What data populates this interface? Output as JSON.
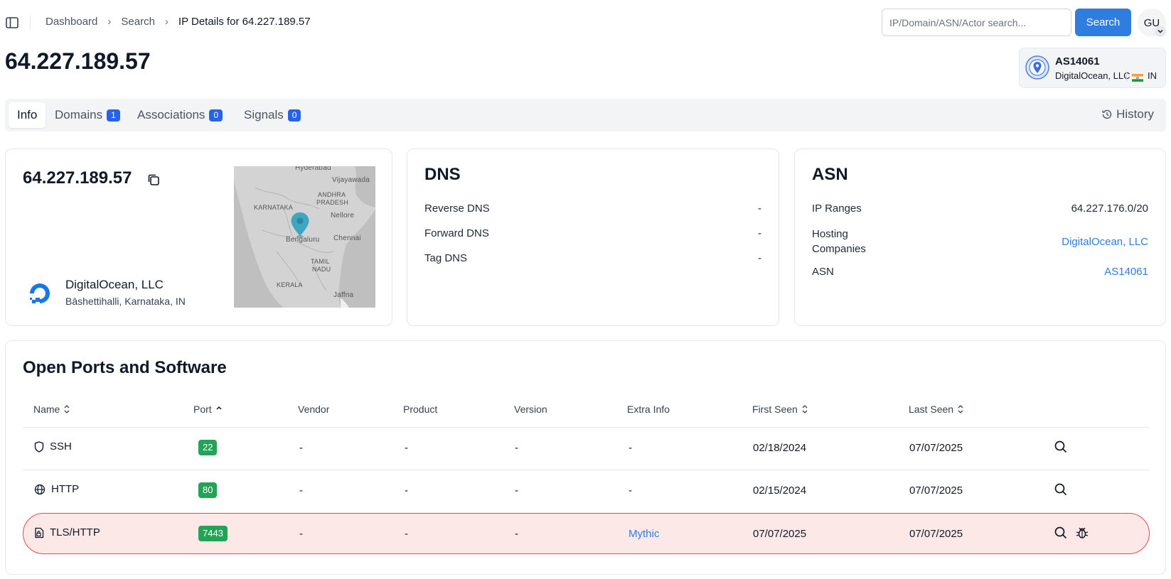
{
  "breadcrumb": {
    "items": [
      "Dashboard",
      "Search"
    ],
    "current": "IP Details for 64.227.189.57"
  },
  "search": {
    "placeholder": "IP/Domain/ASN/Actor search...",
    "value": "",
    "button_label": "Search"
  },
  "user": {
    "initials": "GU"
  },
  "page": {
    "title": "64.227.189.57"
  },
  "asn_badge": {
    "asn": "AS14061",
    "org": "DigitalOcean, LLC",
    "country": "IN"
  },
  "tabs": [
    {
      "label": "Info",
      "count": null,
      "active": true
    },
    {
      "label": "Domains",
      "count": "1"
    },
    {
      "label": "Associations",
      "count": "0"
    },
    {
      "label": "Signals",
      "count": "0"
    }
  ],
  "history_label": "History",
  "ip_card": {
    "ip": "64.227.189.57",
    "hoster": "DigitalOcean, LLC",
    "location": "Bāshettihalli, Karnataka, IN",
    "map_labels": {
      "hyderabad": "Hyderabad",
      "vijayawada": "Vijayawada",
      "andhra": "ANDHRA",
      "pradesh": "PRADESH",
      "karnataka": "KARNATAKA",
      "nellore": "Nellore",
      "bengaluru": "Bengaluru",
      "chennai": "Chennai",
      "tamil": "TAMIL",
      "nadu": "NADU",
      "kerala": "KERALA",
      "jaffna": "Jaffna"
    }
  },
  "dns": {
    "title": "DNS",
    "rows": [
      {
        "label": "Reverse DNS",
        "value": "-"
      },
      {
        "label": "Forward DNS",
        "value": "-"
      },
      {
        "label": "Tag DNS",
        "value": "-"
      }
    ]
  },
  "asn": {
    "title": "ASN",
    "ip_ranges_label": "IP Ranges",
    "ip_ranges_value": "64.227.176.0/20",
    "hosting_label_1": "Hosting",
    "hosting_label_2": "Companies",
    "hosting_value": "DigitalOcean, LLC",
    "asn_label": "ASN",
    "asn_value": "AS14061"
  },
  "ports": {
    "title": "Open Ports and Software",
    "columns": {
      "name": "Name",
      "port": "Port",
      "vendor": "Vendor",
      "product": "Product",
      "version": "Version",
      "extra": "Extra Info",
      "first_seen": "First Seen",
      "last_seen": "Last Seen"
    },
    "rows": [
      {
        "name": "SSH",
        "port": "22",
        "vendor": "-",
        "product": "-",
        "version": "-",
        "extra": "-",
        "first_seen": "02/18/2024",
        "last_seen": "07/07/2025"
      },
      {
        "name": "HTTP",
        "port": "80",
        "vendor": "-",
        "product": "-",
        "version": "-",
        "extra": "-",
        "first_seen": "02/15/2024",
        "last_seen": "07/07/2025"
      },
      {
        "name": "TLS/HTTP",
        "port": "7443",
        "vendor": "-",
        "product": "-",
        "version": "-",
        "extra": "Mythic",
        "first_seen": "07/07/2025",
        "last_seen": "07/07/2025"
      }
    ]
  },
  "colors": {
    "accent": "#2f7de1",
    "badge_blue": "#2563eb",
    "port_green": "#22a355",
    "alert_bg": "#fde8e8",
    "alert_border": "#ef4444"
  }
}
